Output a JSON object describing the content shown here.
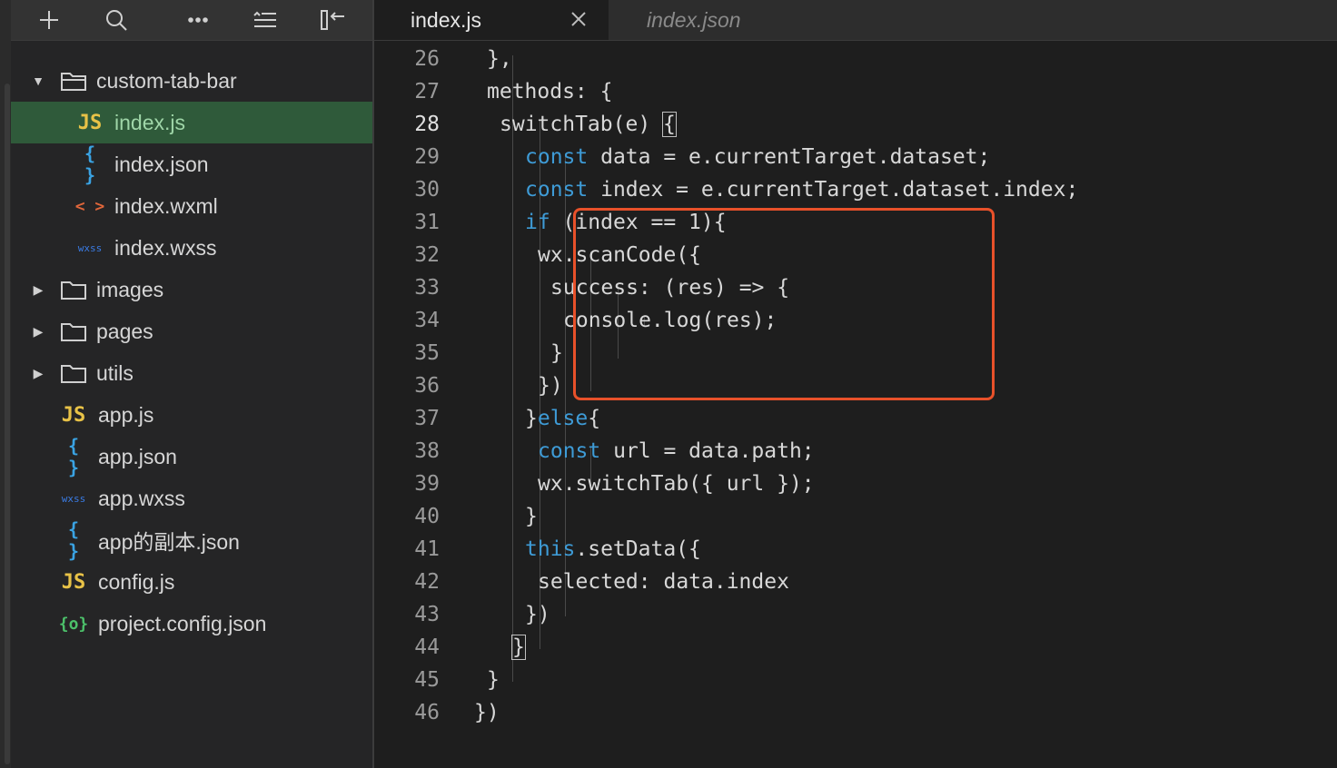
{
  "sidebar": {
    "toolbar": {
      "add": "add-icon",
      "search": "search-icon",
      "more": "more-icon",
      "collapse": "collapse-all-icon",
      "hide": "hide-sidebar-icon"
    },
    "tree": [
      {
        "label": "custom-tab-bar",
        "type": "folder",
        "expanded": true,
        "depth": 0
      },
      {
        "label": "index.js",
        "type": "js",
        "icon_text": "JS",
        "depth": 1,
        "selected": true
      },
      {
        "label": "index.json",
        "type": "json",
        "icon_text": "{ }",
        "depth": 1
      },
      {
        "label": "index.wxml",
        "type": "wxml",
        "icon_text": "< >",
        "depth": 1
      },
      {
        "label": "index.wxss",
        "type": "wxss",
        "icon_text": "wxss",
        "depth": 1
      },
      {
        "label": "images",
        "type": "folder",
        "expanded": false,
        "depth": 0
      },
      {
        "label": "pages",
        "type": "folder",
        "expanded": false,
        "depth": 0
      },
      {
        "label": "utils",
        "type": "folder",
        "expanded": false,
        "depth": 0
      },
      {
        "label": "app.js",
        "type": "js",
        "icon_text": "JS",
        "depth": 0
      },
      {
        "label": "app.json",
        "type": "json",
        "icon_text": "{ }",
        "depth": 0
      },
      {
        "label": "app.wxss",
        "type": "wxss",
        "icon_text": "wxss",
        "depth": 0
      },
      {
        "label": "app的副本.json",
        "type": "json",
        "icon_text": "{ }",
        "depth": 0
      },
      {
        "label": "config.js",
        "type": "js",
        "icon_text": "JS",
        "depth": 0
      },
      {
        "label": "project.config.json",
        "type": "cfg",
        "icon_text": "{o}",
        "depth": 0
      }
    ]
  },
  "tabs": [
    {
      "label": "index.js",
      "active": true
    },
    {
      "label": "index.json",
      "active": false
    }
  ],
  "editor": {
    "current_line": "28",
    "lines": [
      {
        "n": "26",
        "text": "},"
      },
      {
        "n": "27",
        "text": "methods: {"
      },
      {
        "n": "28",
        "text": "switchTab(e) {"
      },
      {
        "n": "29",
        "text": "const data = e.currentTarget.dataset;"
      },
      {
        "n": "30",
        "text": "const index = e.currentTarget.dataset.index;"
      },
      {
        "n": "31",
        "text": "if (index == 1){"
      },
      {
        "n": "32",
        "text": "wx.scanCode({"
      },
      {
        "n": "33",
        "text": "success: (res) => {"
      },
      {
        "n": "34",
        "text": "console.log(res);"
      },
      {
        "n": "35",
        "text": "}"
      },
      {
        "n": "36",
        "text": "})"
      },
      {
        "n": "37",
        "text": "}else{"
      },
      {
        "n": "38",
        "text": "const url = data.path;"
      },
      {
        "n": "39",
        "text": "wx.switchTab({ url });"
      },
      {
        "n": "40",
        "text": "}"
      },
      {
        "n": "41",
        "text": "this.setData({"
      },
      {
        "n": "42",
        "text": "selected: data.index"
      },
      {
        "n": "43",
        "text": "})"
      },
      {
        "n": "44",
        "text": "}"
      },
      {
        "n": "45",
        "text": "}"
      },
      {
        "n": "46",
        "text": "})"
      }
    ],
    "highlight_color": "#e8512a",
    "keyword_color": "#3e9bd6",
    "selection_color": "#2f5a3a"
  }
}
